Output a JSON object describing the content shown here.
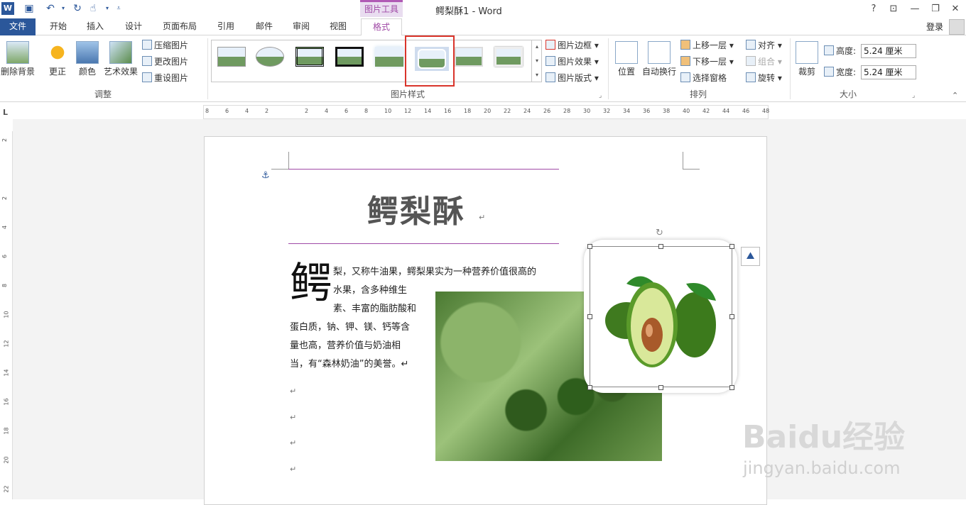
{
  "window": {
    "title": "鳄梨酥1 - Word",
    "context_tab_group": "图片工具",
    "login": "登录",
    "help": "?"
  },
  "tabs": [
    {
      "label": "文件"
    },
    {
      "label": "开始"
    },
    {
      "label": "插入"
    },
    {
      "label": "设计"
    },
    {
      "label": "页面布局"
    },
    {
      "label": "引用"
    },
    {
      "label": "邮件"
    },
    {
      "label": "审阅"
    },
    {
      "label": "视图"
    },
    {
      "label": "格式"
    }
  ],
  "ribbon": {
    "adjust": {
      "remove_bg": "删除背景",
      "corrections": "更正",
      "color": "颜色",
      "artistic": "艺术效果",
      "compress": "压缩图片",
      "change": "更改图片",
      "reset": "重设图片",
      "group_label": "调整"
    },
    "styles": {
      "border": "图片边框",
      "effects": "图片效果",
      "layout": "图片版式",
      "group_label": "图片样式"
    },
    "arrange": {
      "position": "位置",
      "wrap": "自动换行",
      "forward": "上移一层",
      "backward": "下移一层",
      "selection_pane": "选择窗格",
      "align": "对齐",
      "group": "组合",
      "rotate": "旋转",
      "group_label": "排列"
    },
    "size": {
      "crop": "裁剪",
      "height_label": "高度:",
      "height_value": "5.24 厘米",
      "width_label": "宽度:",
      "width_value": "5.24 厘米",
      "group_label": "大小"
    }
  },
  "ruler_h": [
    "8",
    "6",
    "4",
    "2",
    "",
    "2",
    "4",
    "6",
    "8",
    "10",
    "12",
    "14",
    "16",
    "18",
    "20",
    "22",
    "24",
    "26",
    "28",
    "30",
    "32",
    "34",
    "36",
    "38",
    "40",
    "42",
    "44",
    "46",
    "48"
  ],
  "ruler_v": [
    "2",
    "",
    "2",
    "4",
    "6",
    "8",
    "10",
    "12",
    "14",
    "16",
    "18",
    "20",
    "22"
  ],
  "document": {
    "title": "鳄梨酥",
    "dropcap": "鳄",
    "lines": [
      "梨，又称牛油果，鳄梨果实为一种营养价值很高的",
      "水果，含多种维生",
      "素、丰富的脂肪酸和",
      "蛋白质，钠、钾、镁、钙等含",
      "量也高，营养价值与奶油相",
      "当，有“森林奶油”的美誉。↵"
    ],
    "para_mark": "↵"
  },
  "watermark": {
    "brand": "Baidu经验",
    "url": "jingyan.baidu.com"
  }
}
